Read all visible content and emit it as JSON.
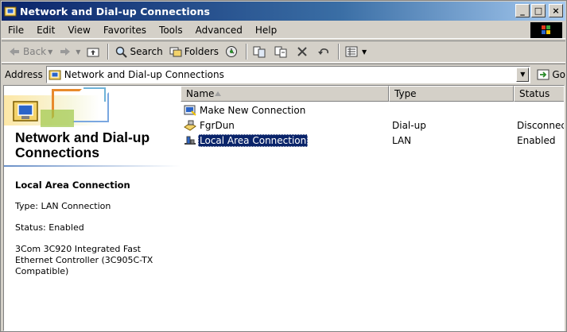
{
  "window": {
    "title": "Network and Dial-up Connections",
    "controls": {
      "minimize": "_",
      "maximize": "□",
      "close": "×"
    }
  },
  "menu": [
    "File",
    "Edit",
    "View",
    "Favorites",
    "Tools",
    "Advanced",
    "Help"
  ],
  "toolbar": {
    "back_label": "Back",
    "search_label": "Search",
    "folders_label": "Folders"
  },
  "address": {
    "label": "Address",
    "value": "Network and Dial-up Connections",
    "go_label": "Go"
  },
  "left_pane": {
    "title": "Network and Dial-up Connections",
    "selected_name": "Local Area Connection",
    "selected_type": "Type: LAN Connection",
    "selected_status": "Status: Enabled",
    "selected_device": "3Com 3C920 Integrated Fast Ethernet Controller (3C905C-TX Compatible)"
  },
  "columns": {
    "name": "Name",
    "type": "Type",
    "status": "Status"
  },
  "rows": [
    {
      "name": "Make New Connection",
      "type": "",
      "status": "",
      "icon": "wizard-icon"
    },
    {
      "name": "FgrDun",
      "type": "Dial-up",
      "status": "Disconnect",
      "icon": "dialup-icon"
    },
    {
      "name": "Local Area Connection",
      "type": "LAN",
      "status": "Enabled",
      "icon": "lan-icon",
      "selected": true
    }
  ]
}
